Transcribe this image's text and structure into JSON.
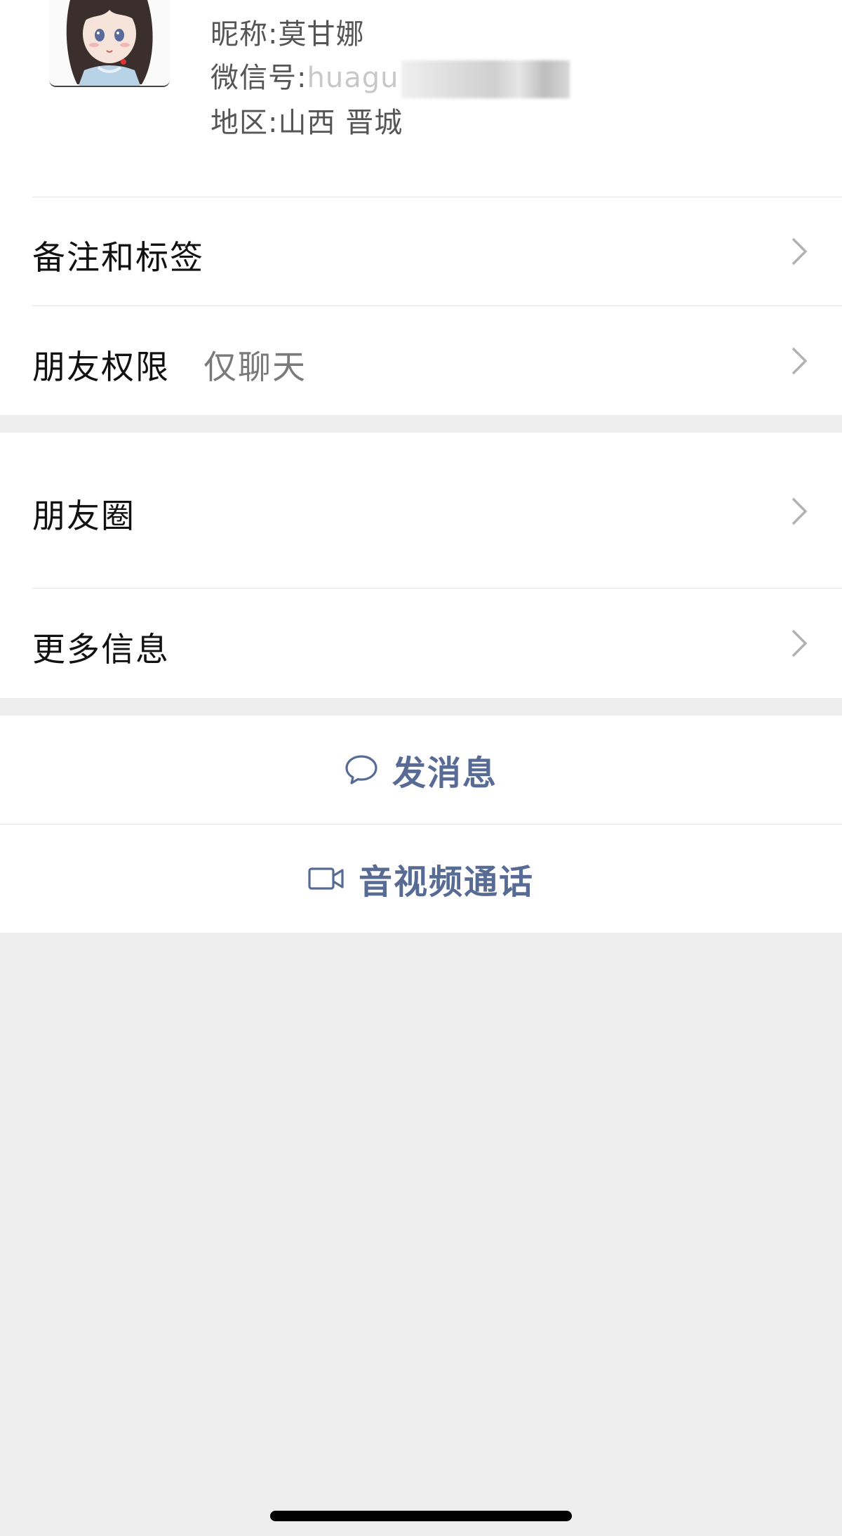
{
  "profile": {
    "nickname_label": "昵称",
    "nickname_value": "莫甘娜",
    "wechat_id_label": "微信号",
    "wechat_id_visible": "huagu",
    "region_label": "地区",
    "region_value": "山西 晋城",
    "separator": ":"
  },
  "rows": {
    "remarks_label": "备注和标签",
    "permission_label": "朋友权限",
    "permission_value": "仅聊天",
    "moments_label": "朋友圈",
    "more_info_label": "更多信息"
  },
  "actions": {
    "message_label": "发消息",
    "call_label": "音视频通话"
  },
  "colors": {
    "background": "#ededed",
    "surface": "#ffffff",
    "link_blue": "#576b95",
    "secondary_text": "#7a7a7a",
    "chevron": "#b2b2b2"
  },
  "icons": {
    "message": "chat-bubble-icon",
    "call": "video-camera-icon",
    "row_arrow": "chevron-right-icon"
  }
}
